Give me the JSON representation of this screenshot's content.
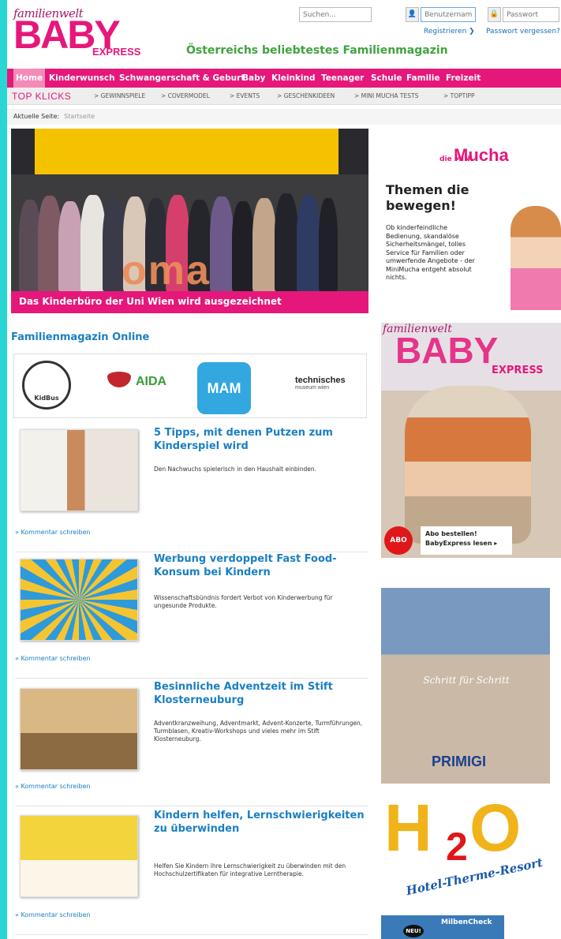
{
  "header": {
    "logo_small": "familienwelt",
    "logo_big": "BABY",
    "logo_express": "EXPRESS",
    "tagline": "Österreichs beliebtestes Familienmagazin",
    "search_placeholder": "Suchen...",
    "username_placeholder": "Benutzername",
    "password_placeholder": "Passwort",
    "register_link": "Registrieren ❯",
    "forgot_link": "Passwort vergessen?"
  },
  "main_nav": [
    "Home",
    "Kinderwunsch",
    "Schwangerschaft & Geburt",
    "Baby",
    "Kleinkind",
    "Teenager",
    "Schule",
    "Familie",
    "Freizeit"
  ],
  "top_bar": {
    "label": "TOP KLICKS",
    "items": [
      "> GEWINNSPIELE",
      "> COVERMODEL",
      "> EVENTS",
      "> GESCHENKIDEEN",
      "> MINI MUCHA TESTS",
      "> TOPTIPP"
    ]
  },
  "breadcrumb": {
    "label": "Aktuelle Seite:",
    "current": "Startseite"
  },
  "hero": {
    "caption": "Das Kinderbüro der Uni Wien wird ausgezeichnet",
    "stage_text": "oma"
  },
  "mucha_ad": {
    "logo_prefix": "die MINI",
    "logo": "Mucha",
    "headline": "Themen die bewegen!",
    "text": "Ob kinderfeindliche Bedienung, skandalöse Sicherheitsmängel, tolles Service für Familien oder umwerfende Angebote - der MiniMucha entgeht absolut nichts."
  },
  "section_title": "Familienmagazin Online",
  "partners": {
    "kidbus": "KidBus",
    "aida": "AIDA",
    "mam": "MAM",
    "tm_line1": "technisches",
    "tm_line2": "museum wien"
  },
  "articles": [
    {
      "title": "5 Tipps, mit denen Putzen zum Kinderspiel wird",
      "teaser": "Den Nachwuchs spielerisch in den Haushalt einbinden.",
      "comment": "» Kommentar schreiben"
    },
    {
      "title": "Werbung verdoppelt Fast Food-Konsum bei Kindern",
      "teaser": "Wissenschaftsbündnis fordert Verbot von Kinderwerbung für ungesunde Produkte.",
      "comment": "» Kommentar schreiben"
    },
    {
      "title": "Besinnliche Adventzeit im Stift Klosterneuburg",
      "teaser": "Adventkranzweihung, Adventmarkt, Advent-Konzerte, Turmführungen, Turmblasen, Kreativ-Workshops und vieles mehr im Stift Klosterneuburg.",
      "comment": "» Kommentar schreiben"
    },
    {
      "title": "Kindern helfen, Lernschwierigkeiten zu überwinden",
      "teaser": "Helfen Sie Kindern ihre Lernschwierigkeit zu überwinden mit den Hochschulzertifikaten für integrative Lerntherapie.",
      "comment": "» Kommentar schreiben"
    }
  ],
  "babyexpress_ad": {
    "small": "familienwelt",
    "big": "BABY",
    "express": "EXPRESS",
    "abo": "ABO",
    "abo_text1": "Abo bestellen!",
    "abo_text2": "BabyExpress lesen ▸"
  },
  "primigi_ad": {
    "tagline": "Schritt für Schritt",
    "logo": "PRIMIGI"
  },
  "h2o_ad": {
    "h": "H",
    "two": "2",
    "o": "O",
    "sub": "Hotel-Therme-Resort"
  },
  "milben_ad": {
    "new": "NEU!",
    "text": "MilbenCheck"
  }
}
